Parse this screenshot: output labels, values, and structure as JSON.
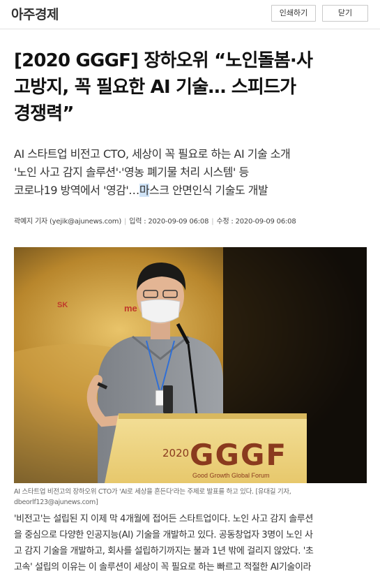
{
  "header": {
    "logo": "아주경제",
    "print_label": "인쇄하기",
    "close_label": "닫기"
  },
  "article": {
    "title_lines": [
      "[2020 GGGF] 장하오위 “노인돌봄·사",
      "고방지, 꼭 필요한 AI 기술… 스피드가",
      "경쟁력”"
    ],
    "subtitles": [
      "AI 스타트업 비전고 CTO, 세상이 꼭 필요로 하는 AI 기술 소개",
      "'노인 사고 감지 솔루션'·'영농 폐기물 처리 시스템' 등",
      {
        "before": "코로나19 방역에서 '영감'…",
        "highlight": "마",
        "after": "스크 안면인식 기술도 개발"
      }
    ],
    "byline": {
      "author": "곽예지 기자 (yejik@ajunews.com)",
      "published": "입력 : 2020-09-09 06:08",
      "modified": "수정 : 2020-09-09 06:08"
    },
    "photo": {
      "stage_year": "2020",
      "stage_brand": "GGGF",
      "stage_tagline": "Good Growth Global Forum",
      "bg_text_sk": "SK",
      "bg_text_me": "me"
    },
    "caption": "AI 스타트업 비전고의 장하오위 CTO가 'AI로 세상을 흔든다'라는 주제로 발표를 하고 있다. [유대길 기자, dbeorlf123@ajunews.com]",
    "body_lines": [
      "'비전고'는 설립된 지 이제 막 4개월에 접어든 스타트업이다. 노인 사고 감지 솔루션",
      "을 중심으로 다양한 인공지능(AI) 기술을 개발하고 있다. 공동창업자 3명이 노인 사",
      "고 감지 기술을 개발하고, 회사를 설립하기까지는 불과 1년 밖에 걸리지 않았다. '초",
      "고속' 설립의 이유는 이 솔루션이 세상이 꼭 필요로 하는 빠르고 적절한 AI기술이라"
    ]
  },
  "colors": {
    "stage_brown": "#8a3a1e",
    "podium_yellow": "#f0d98a",
    "highlight": "#cfe3f7"
  }
}
